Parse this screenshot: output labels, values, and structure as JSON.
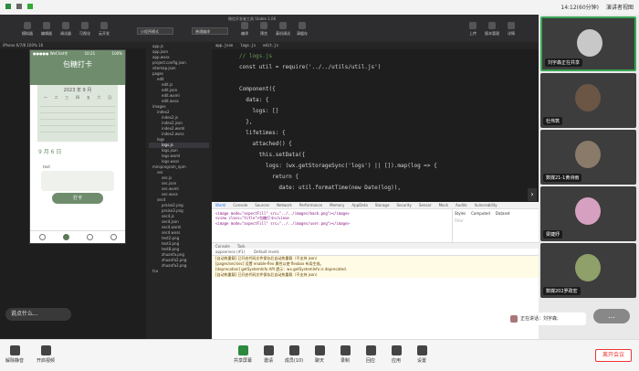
{
  "topbar": {
    "time": "14:12(60分钟)",
    "presenter_view": "演讲者视图"
  },
  "ide": {
    "title": "微信开发者工具 Stable 1.06",
    "toolbar_left": [
      "模拟器",
      "编辑器",
      "调试器",
      "可视化",
      "云开发"
    ],
    "mode": "小程序模式",
    "compile": "普通编译",
    "toolbar_mid": [
      "编译",
      "预览",
      "真机调试",
      "清缓存"
    ],
    "toolbar_right": [
      "上传",
      "版本管理",
      "详情"
    ],
    "device": "iPhone 6/7/8 100% 16"
  },
  "phone": {
    "status_left": "●●●●● WeChat令",
    "status_time": "10:21",
    "status_right": "100%",
    "title": "包糖打卡",
    "month": "2023 年 9 月",
    "weekdays": [
      "一",
      "二",
      "三",
      "四",
      "五",
      "六",
      "日"
    ],
    "date": "9 月 6 日",
    "text": "text",
    "button": "打卡"
  },
  "files": [
    "app.js",
    "app.json",
    "app.wxss",
    "project.config.json",
    "sitemap.json",
    "pages",
    "edit",
    "edit.js",
    "edit.json",
    "edit.wxml",
    "edit.wxss",
    "images",
    "index2",
    "index2.js",
    "index2.json",
    "index2.wxml",
    "index2.wxss",
    "logs",
    "logs.js",
    "logs.json",
    "logs.wxml",
    "logs.wxss",
    "miniprogram_npm",
    "sec",
    "sec.js",
    "sec.json",
    "sec.wxml",
    "sec.wxss",
    "sec4",
    "praise2.png",
    "praise3.png",
    "sec4.js",
    "sec4.json",
    "sec4.wxml",
    "sec4.wxss",
    "test2.png",
    "test3.png",
    "test8.png",
    "zhuanfa.png",
    "zhuanfa2.png",
    "zhuanfa3.png",
    "tcu"
  ],
  "editor": {
    "tabs": [
      "app.json",
      "logs.js",
      "edit.js"
    ],
    "lines": [
      "// logs.js",
      "const util = require('../../utils/util.js')",
      "",
      "Component({",
      "  data: {",
      "    logs: []",
      "  },",
      "  lifetimes: {",
      "    attached() {",
      "      this.setData({",
      "        logs: (wx.getStorageSync('logs') || []).map(log => {",
      "          return {",
      "            date: util.formatTime(new Date(log)),"
    ]
  },
  "devtools": {
    "tabs": [
      "Wxml",
      "Console",
      "Sources",
      "Network",
      "Performance",
      "Memory",
      "AppData",
      "Storage",
      "Security",
      "Sensor",
      "Mock",
      "Audits",
      "Vulnerability"
    ],
    "style_tabs": [
      "Styles",
      "Computed",
      "Dataset"
    ],
    "filter": "Filter",
    "wxml_lines": [
      "<image mode=\"aspectFill\" src=\"../../images/back.png\"></image>",
      "<view class=\"title\">包糖打卡</view>",
      "<image mode=\"aspectFill\" src=\"../../images/user.png\"></image>"
    ],
    "console_tabs": [
      "Console",
      "Task"
    ],
    "context": "appservice (#1)",
    "levels": "Default levels",
    "console_lines": [
      "[自动热重载] 已开启代码文件保存后自动热重载（不支持 json）",
      "[pages/sec/sec] 设置 enable-flex 属性以使 flexbox 布局生效。",
      "[deprecation] getSystemInfo API 提示：wx.getSystemInfo is deprecated.",
      "[自动热重载] 已开启代码文件保存后自动热重载（不支持 json）"
    ]
  },
  "danmu": "说点什么...",
  "tiles": [
    {
      "name": "刘宇森正在共享",
      "color": "#c8c8c8"
    },
    {
      "name": "杜伟筑",
      "color": "#6b5646"
    },
    {
      "name": "数媒21-1黄诗雨",
      "color": "#8a7a6a"
    },
    {
      "name": "梁婕妤",
      "color": "#d6a0c0"
    },
    {
      "name": "数媒202罗政宏",
      "color": "#8fa06a"
    }
  ],
  "speaking": "正在讲话：刘宇森;",
  "bottom_left": [
    "解除静音",
    "开启视频"
  ],
  "bottom_mid": [
    "共享屏幕",
    "邀请",
    "成员(10)",
    "聊天",
    "录制",
    "回应",
    "应用",
    "设置"
  ],
  "leave": "离开会议"
}
